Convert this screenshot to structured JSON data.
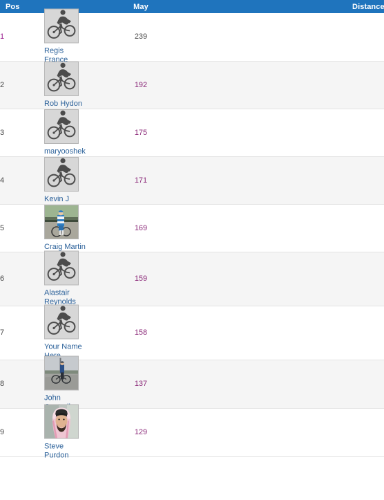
{
  "header": {
    "col_pos": "Pos",
    "col_month": "May",
    "col_distance": "Distance (miles)",
    "accent_color": "#1f74bd",
    "header_text_color": "#ffffff"
  },
  "colors": {
    "link": "#2a6099",
    "visited_link": "#9b1f8f",
    "row_alt_bg": "#f5f5f5",
    "row_bg": "#ffffff",
    "row_border": "#e3e3e3",
    "avatar_border": "#b6b6b6",
    "avatar_placeholder_bg": "#d7d7d7",
    "text": "#4a4a4a"
  },
  "rows": [
    {
      "pos": "1",
      "pos_visited": true,
      "name": "Regis France",
      "avatar_type": "cyclist-silhouette",
      "avatar_name": "avatar-placeholder-cyclist",
      "month_value": "239",
      "distance_value": "239",
      "value_visited": false
    },
    {
      "pos": "2",
      "pos_visited": false,
      "name": "Rob Hydon",
      "avatar_type": "cyclist-silhouette",
      "avatar_name": "avatar-placeholder-cyclist",
      "month_value": "192",
      "distance_value": "192",
      "value_visited": true
    },
    {
      "pos": "3",
      "pos_visited": false,
      "name": "maryooshek",
      "avatar_type": "cyclist-silhouette",
      "avatar_name": "avatar-placeholder-cyclist",
      "month_value": "175",
      "distance_value": "175",
      "value_visited": true
    },
    {
      "pos": "4",
      "pos_visited": false,
      "name": "Kevin J",
      "avatar_type": "cyclist-silhouette",
      "avatar_name": "avatar-placeholder-cyclist",
      "month_value": "171",
      "distance_value": "171",
      "value_visited": true
    },
    {
      "pos": "5",
      "pos_visited": false,
      "name": "Craig Martin",
      "avatar_type": "photo-cyclist-blue-jersey",
      "avatar_name": "avatar-photo-craig-martin",
      "month_value": "169",
      "distance_value": "169",
      "value_visited": true
    },
    {
      "pos": "6",
      "pos_visited": false,
      "name": "Alastair Reynolds",
      "avatar_type": "cyclist-silhouette",
      "avatar_name": "avatar-placeholder-cyclist",
      "month_value": "159",
      "distance_value": "159",
      "value_visited": true
    },
    {
      "pos": "7",
      "pos_visited": false,
      "name": "Your Name Here",
      "avatar_type": "cyclist-silhouette",
      "avatar_name": "avatar-placeholder-cyclist",
      "month_value": "158",
      "distance_value": "158",
      "value_visited": true
    },
    {
      "pos": "8",
      "pos_visited": false,
      "name": "John Cantrell",
      "avatar_type": "photo-cyclist-road",
      "avatar_name": "avatar-photo-john-cantrell",
      "month_value": "137",
      "distance_value": "137",
      "value_visited": true
    },
    {
      "pos": "9",
      "pos_visited": false,
      "name": "Steve Purdon",
      "avatar_type": "photo-person-keffiyeh",
      "avatar_name": "avatar-photo-steve-purdon",
      "month_value": "129",
      "distance_value": "129",
      "value_visited": true
    }
  ]
}
